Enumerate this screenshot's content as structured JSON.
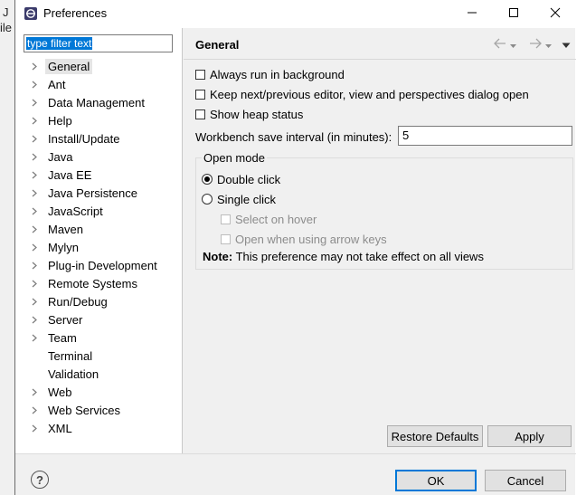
{
  "window": {
    "title": "Preferences",
    "minimize_icon": "minimize-icon",
    "maximize_icon": "maximize-icon",
    "close_icon": "close-icon"
  },
  "background_app": {
    "fragments": [
      "J",
      "ile"
    ]
  },
  "filter": {
    "value": "type filter text"
  },
  "tree": {
    "items": [
      {
        "label": "General",
        "expandable": true,
        "selected": true
      },
      {
        "label": "Ant",
        "expandable": true
      },
      {
        "label": "Data Management",
        "expandable": true
      },
      {
        "label": "Help",
        "expandable": true
      },
      {
        "label": "Install/Update",
        "expandable": true
      },
      {
        "label": "Java",
        "expandable": true
      },
      {
        "label": "Java EE",
        "expandable": true
      },
      {
        "label": "Java Persistence",
        "expandable": true
      },
      {
        "label": "JavaScript",
        "expandable": true
      },
      {
        "label": "Maven",
        "expandable": true
      },
      {
        "label": "Mylyn",
        "expandable": true
      },
      {
        "label": "Plug-in Development",
        "expandable": true
      },
      {
        "label": "Remote Systems",
        "expandable": true
      },
      {
        "label": "Run/Debug",
        "expandable": true
      },
      {
        "label": "Server",
        "expandable": true
      },
      {
        "label": "Team",
        "expandable": true
      },
      {
        "label": "Terminal",
        "expandable": false
      },
      {
        "label": "Validation",
        "expandable": false
      },
      {
        "label": "Web",
        "expandable": true
      },
      {
        "label": "Web Services",
        "expandable": true
      },
      {
        "label": "XML",
        "expandable": true
      }
    ]
  },
  "page": {
    "title": "General",
    "options": {
      "always_run_bg": {
        "label": "Always run in background",
        "checked": false
      },
      "keep_next_prev": {
        "label": "Keep next/previous editor, view and perspectives dialog open",
        "checked": false
      },
      "show_heap": {
        "label": "Show heap status",
        "checked": false
      }
    },
    "save_interval": {
      "label": "Workbench save interval (in minutes):",
      "value": "5"
    },
    "open_mode": {
      "title": "Open mode",
      "double_click": {
        "label": "Double click",
        "selected": true
      },
      "single_click": {
        "label": "Single click",
        "selected": false
      },
      "select_on_hover": {
        "label": "Select on hover",
        "checked": false,
        "enabled": false
      },
      "open_arrow_keys": {
        "label": "Open when using arrow keys",
        "checked": false,
        "enabled": false
      },
      "note_label": "Note:",
      "note_text": "This preference may not take effect on all views"
    }
  },
  "buttons": {
    "restore_defaults": "Restore Defaults",
    "apply": "Apply",
    "ok": "OK",
    "cancel": "Cancel",
    "help": "?"
  }
}
